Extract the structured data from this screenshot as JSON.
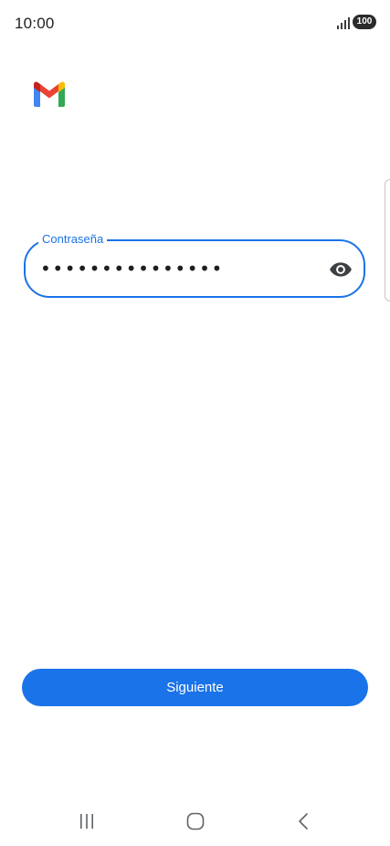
{
  "status_bar": {
    "time": "10:00",
    "battery": "100",
    "icons": [
      "signal-icon",
      "battery-icon"
    ]
  },
  "app": {
    "logo": "gmail-logo"
  },
  "password_field": {
    "label": "Contraseña",
    "value": "•••••••••••••••",
    "toggle_icon": "eye-icon"
  },
  "actions": {
    "next_label": "Siguiente"
  },
  "nav_bar": {
    "icons": [
      "recent-apps-icon",
      "home-icon",
      "back-icon"
    ]
  },
  "colors": {
    "accent": "#1a73e8",
    "text": "#1f1f1f"
  }
}
